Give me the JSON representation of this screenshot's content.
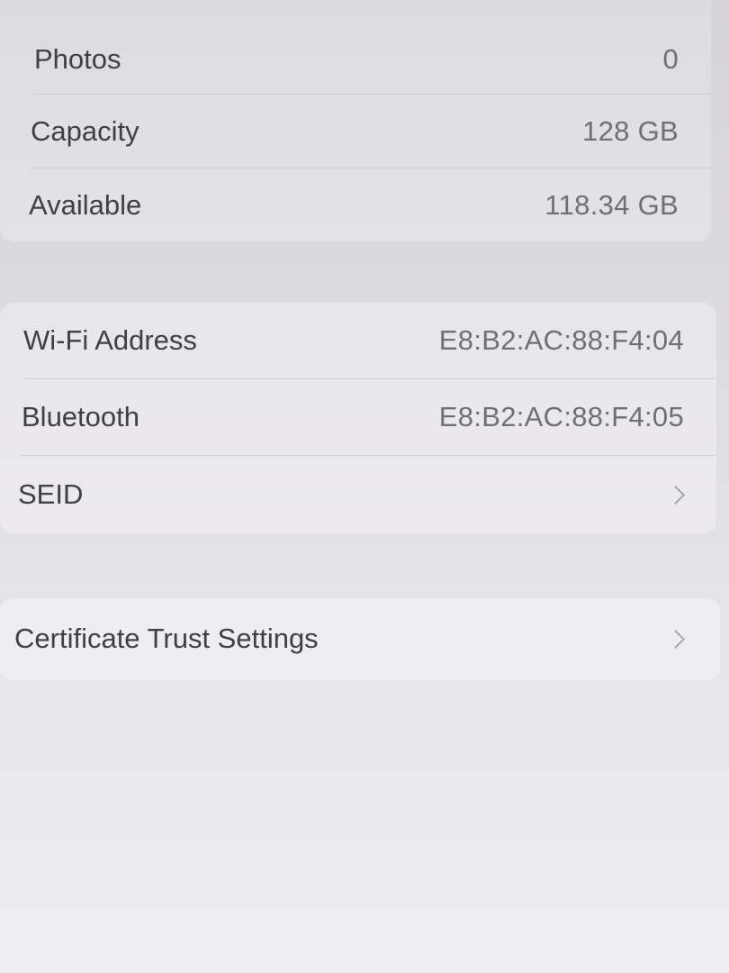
{
  "storage": {
    "photos_label": "Photos",
    "photos_value": "0",
    "capacity_label": "Capacity",
    "capacity_value": "128 GB",
    "available_label": "Available",
    "available_value": "118.34 GB"
  },
  "network": {
    "wifi_label": "Wi-Fi Address",
    "wifi_value": "E8:B2:AC:88:F4:04",
    "bluetooth_label": "Bluetooth",
    "bluetooth_value": "E8:B2:AC:88:F4:05",
    "seid_label": "SEID"
  },
  "certificates": {
    "trust_settings_label": "Certificate Trust Settings"
  },
  "icons": {
    "seid_chevron": "chevron-right-icon",
    "cert_chevron": "chevron-right-icon"
  }
}
